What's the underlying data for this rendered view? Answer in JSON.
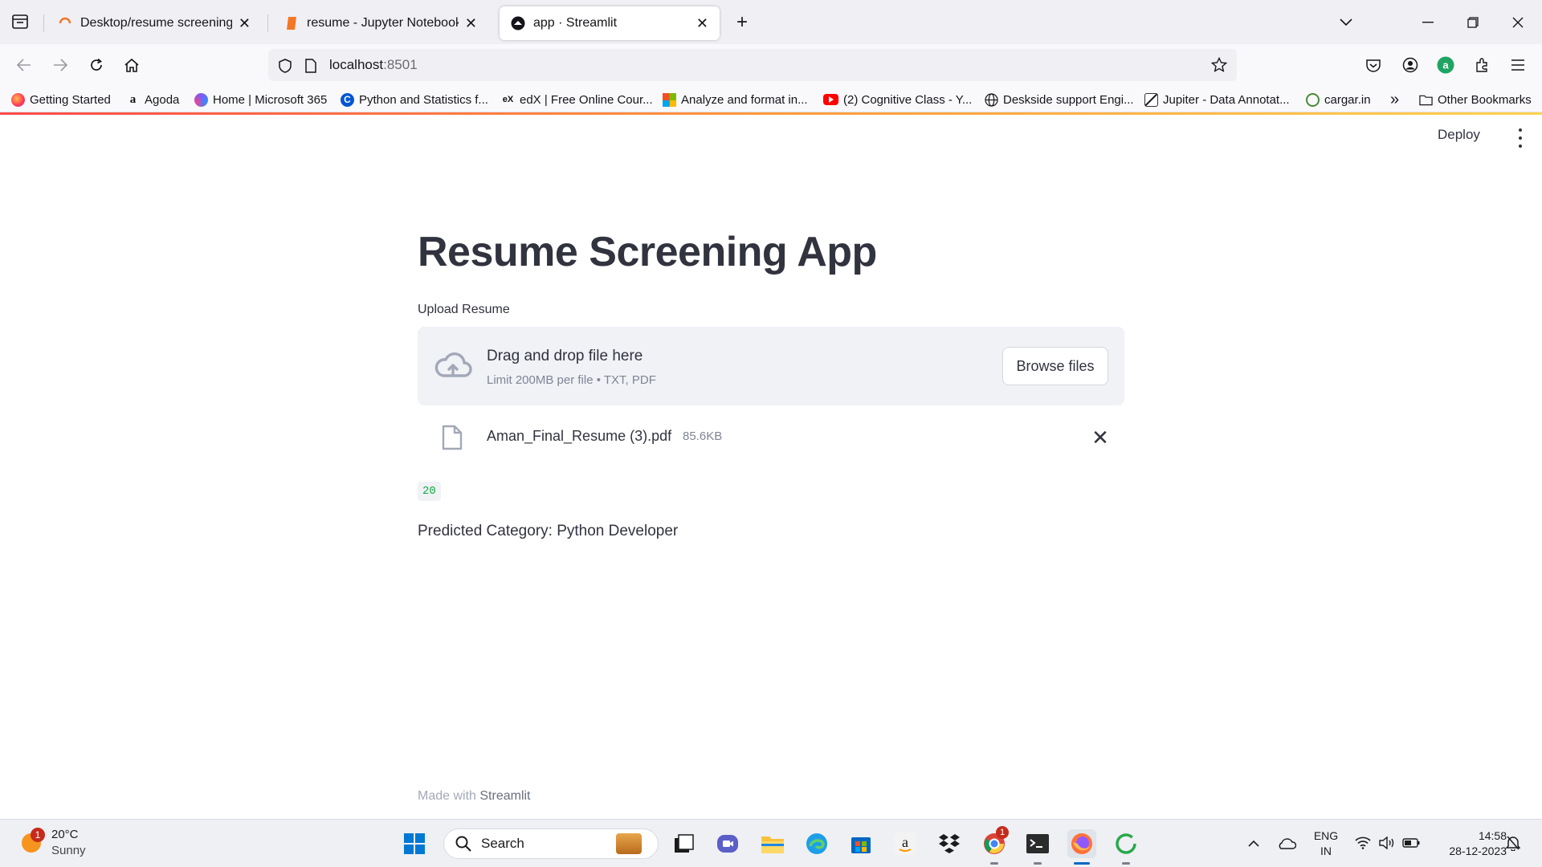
{
  "browser": {
    "tabs": [
      {
        "label": "Desktop/resume screening app/",
        "close": "✕"
      },
      {
        "label": "resume - Jupyter Notebook",
        "close": "✕"
      },
      {
        "label": "app · Streamlit",
        "close": "✕"
      }
    ],
    "new_tab": "+",
    "url_host": "localhost",
    "url_port": ":8501",
    "bookmarks": [
      {
        "label": "Getting Started",
        "icon": "firefox-icon"
      },
      {
        "label": "Agoda",
        "icon": "amazon-icon"
      },
      {
        "label": "Home | Microsoft 365",
        "icon": "m365-icon"
      },
      {
        "label": "Python and Statistics f...",
        "icon": "coursera-icon"
      },
      {
        "label": "edX | Free Online Cour...",
        "icon": "edx-icon"
      },
      {
        "label": "Analyze and format in...",
        "icon": "microsoft-icon"
      },
      {
        "label": "(2) Cognitive Class - Y...",
        "icon": "youtube-icon"
      },
      {
        "label": "Deskside support Engi...",
        "icon": "globe-icon"
      },
      {
        "label": "Jupiter - Data Annotat...",
        "icon": "jupiter-icon"
      },
      {
        "label": "cargar.in",
        "icon": "cargar-icon"
      }
    ],
    "overflow": "»",
    "other_bookmarks": "Other Bookmarks"
  },
  "app": {
    "deploy_label": "Deploy",
    "title": "Resume Screening App",
    "upload_label": "Upload Resume",
    "dropzone_title": "Drag and drop file here",
    "dropzone_subtitle": "Limit 200MB per file • TXT, PDF",
    "browse_label": "Browse files",
    "file_name": "Aman_Final_Resume (3).pdf",
    "file_size": "85.6KB",
    "remove_symbol": "✕",
    "output_number": "20",
    "prediction": "Predicted Category: Python Developer",
    "footer_prefix": "Made with ",
    "footer_brand": "Streamlit"
  },
  "taskbar": {
    "weather_temp": "20°C",
    "weather_desc": "Sunny",
    "weather_badge": "1",
    "search_placeholder": "Search",
    "lang_top": "ENG",
    "lang_bottom": "IN",
    "time": "14:58",
    "date": "28-12-2023",
    "chrome_badge": "1"
  },
  "colors": {
    "accent": "#ff4b4b",
    "success_text": "#09ab3b",
    "dropzone_bg": "#f0f2f6",
    "text": "#31333f"
  }
}
